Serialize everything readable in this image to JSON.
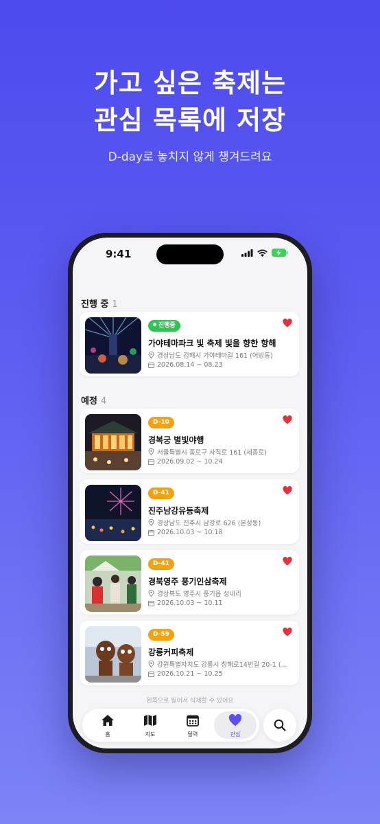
{
  "promo": {
    "headline_line1": "가고 싶은 축제는",
    "headline_line2": "관심 목록에 저장",
    "subheadline": "D-day로 놓치지 않게 챙겨드려요"
  },
  "status_bar": {
    "time": "9:41"
  },
  "sections": {
    "ongoing": {
      "title": "진행 중",
      "count": "1"
    },
    "upcoming": {
      "title": "예정",
      "count": "4"
    }
  },
  "festivals": [
    {
      "badge": "진행중",
      "title": "가야테마파크 빛 축제 빛을 향한 항해",
      "address": "경상남도 김해시 가야테마길 161 (어방동)",
      "dates": "2026.08.14 ~ 08.23"
    },
    {
      "badge": "D-10",
      "title": "경복궁 별빛야행",
      "address": "서울특별시 종로구 사직로 161 (세종로)",
      "dates": "2026.09.02 ~ 10.24"
    },
    {
      "badge": "D-41",
      "title": "진주남강유등축제",
      "address": "경상남도 진주시 남강로 626 (본성동)",
      "dates": "2026.10.03 ~ 10.18"
    },
    {
      "badge": "D-41",
      "title": "경북영주 풍기인삼축제",
      "address": "경상북도 영주시 풍기읍 성내리",
      "dates": "2026.10.03 ~ 10.11"
    },
    {
      "badge": "D-59",
      "title": "강릉커피축제",
      "address": "강원특별자치도 강릉시 창해로14번길 20-1 (...",
      "dates": "2026.10.21 ~ 10.25"
    }
  ],
  "hint": "왼쪽으로 밀어서 삭제할 수 있어요",
  "tabs": [
    {
      "label": "홈",
      "icon": "home-icon"
    },
    {
      "label": "지도",
      "icon": "map-icon"
    },
    {
      "label": "달력",
      "icon": "calendar-icon"
    },
    {
      "label": "관심",
      "icon": "heart-icon"
    }
  ],
  "colors": {
    "accent": "#5b4ff0",
    "live_badge": "#2dc653",
    "dday_badge": "#f5a20a",
    "heart": "#e8303a",
    "background_top": "#4d4aee",
    "background_bottom": "#7c84f6"
  }
}
